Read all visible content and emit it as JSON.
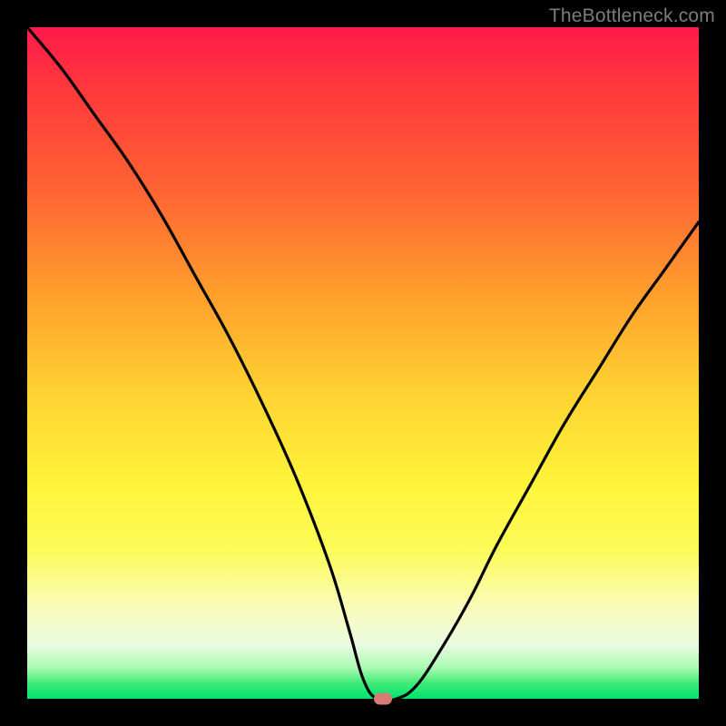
{
  "watermark": "TheBottleneck.com",
  "colors": {
    "background": "#000000",
    "curve": "#000000",
    "marker": "#d87b75",
    "gradient_top": "#ff1a4a",
    "gradient_bottom": "#00e36e"
  },
  "chart_data": {
    "type": "line",
    "title": "",
    "xlabel": "",
    "ylabel": "",
    "xlim": [
      0,
      100
    ],
    "ylim": [
      0,
      100
    ],
    "grid": false,
    "legend": false,
    "series": [
      {
        "name": "bottleneck-curve",
        "x": [
          0,
          5,
          10,
          15,
          20,
          25,
          30,
          35,
          40,
          45,
          48,
          50,
          52,
          55,
          58,
          62,
          66,
          70,
          75,
          80,
          85,
          90,
          95,
          100
        ],
        "values": [
          100,
          94,
          87,
          80,
          72,
          63,
          54,
          44,
          33,
          20,
          10,
          3,
          0,
          0,
          2,
          8,
          15,
          23,
          32,
          41,
          49,
          57,
          64,
          71
        ]
      }
    ],
    "annotations": [
      {
        "name": "optimal-point-marker",
        "x": 53,
        "y": 0
      }
    ],
    "background_gradient_stops": [
      {
        "pos": 0.0,
        "color": "#ff1a4a"
      },
      {
        "pos": 0.1,
        "color": "#ff3b3b"
      },
      {
        "pos": 0.25,
        "color": "#ff6633"
      },
      {
        "pos": 0.4,
        "color": "#ffa02c"
      },
      {
        "pos": 0.55,
        "color": "#ffd433"
      },
      {
        "pos": 0.68,
        "color": "#fff43a"
      },
      {
        "pos": 0.78,
        "color": "#fcfc5a"
      },
      {
        "pos": 0.86,
        "color": "#fbfcb8"
      },
      {
        "pos": 0.92,
        "color": "#e9fbe0"
      },
      {
        "pos": 0.955,
        "color": "#a8fab0"
      },
      {
        "pos": 0.975,
        "color": "#46eb7a"
      },
      {
        "pos": 1.0,
        "color": "#00e36e"
      }
    ]
  }
}
